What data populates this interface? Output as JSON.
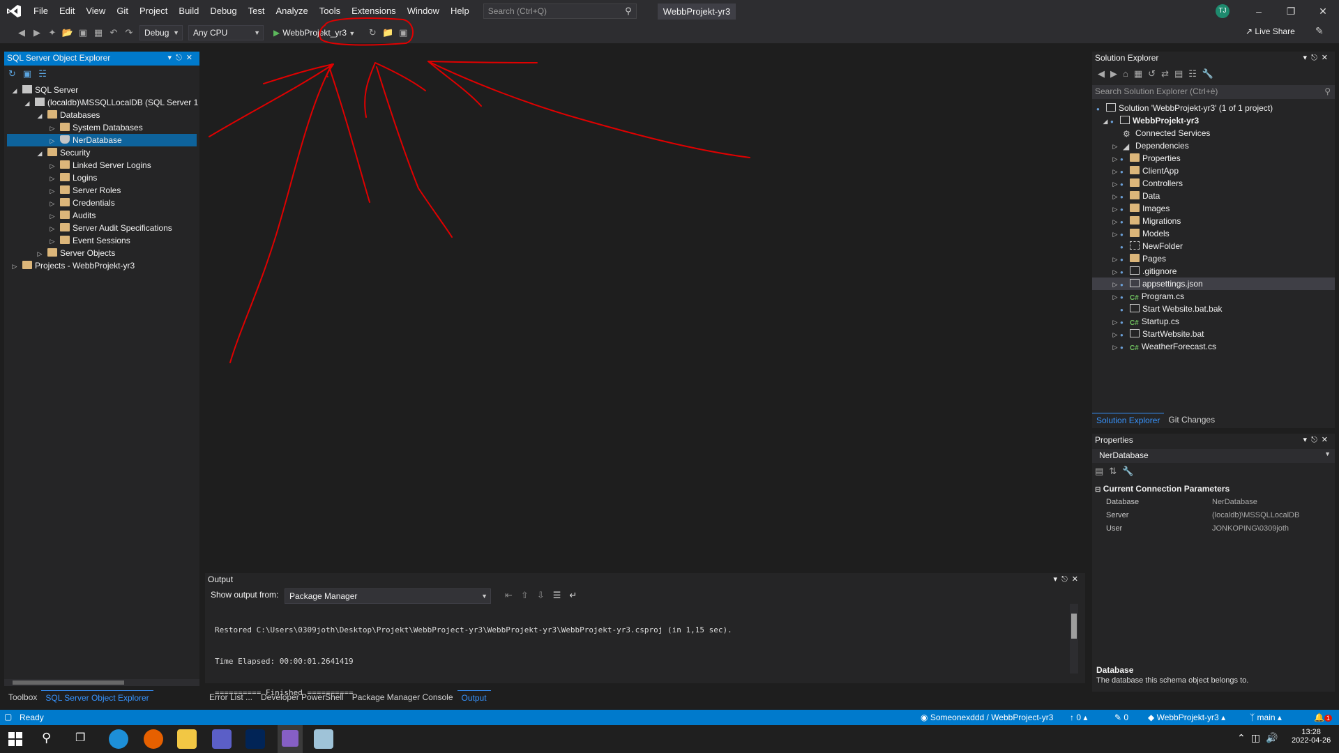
{
  "titlebar": {
    "menus": [
      "File",
      "Edit",
      "View",
      "Git",
      "Project",
      "Build",
      "Debug",
      "Test",
      "Analyze",
      "Tools",
      "Extensions",
      "Window",
      "Help"
    ],
    "search_placeholder": "Search (Ctrl+Q)",
    "solution_name": "WebbProjekt-yr3",
    "avatar_initials": "TJ"
  },
  "toolbar": {
    "config": "Debug",
    "platform": "Any CPU",
    "startup_project": "WebbProjekt_yr3",
    "live_share": "Live Share"
  },
  "sql_explorer": {
    "title": "SQL Server Object Explorer",
    "nodes": [
      {
        "label": "SQL Server",
        "icon": "server-icon"
      },
      {
        "label": "(localdb)\\MSSQLLocalDB (SQL Server 1",
        "icon": "server-instance-icon"
      },
      {
        "label": "Databases",
        "icon": "folder-icon"
      },
      {
        "label": "System Databases",
        "icon": "folder-icon"
      },
      {
        "label": "NerDatabase",
        "icon": "database-icon"
      },
      {
        "label": "Security",
        "icon": "folder-icon"
      },
      {
        "label": "Linked Server Logins",
        "icon": "folder-icon"
      },
      {
        "label": "Logins",
        "icon": "folder-icon"
      },
      {
        "label": "Server Roles",
        "icon": "folder-icon"
      },
      {
        "label": "Credentials",
        "icon": "folder-icon"
      },
      {
        "label": "Audits",
        "icon": "folder-icon"
      },
      {
        "label": "Server Audit Specifications",
        "icon": "folder-icon"
      },
      {
        "label": "Event Sessions",
        "icon": "folder-icon"
      },
      {
        "label": "Server Objects",
        "icon": "folder-icon"
      },
      {
        "label": "Projects - WebbProjekt-yr3",
        "icon": "folder-icon"
      }
    ],
    "tabs": [
      "Toolbox",
      "SQL Server Object Explorer"
    ]
  },
  "solution_explorer": {
    "title": "Solution Explorer",
    "search_placeholder": "Search Solution Explorer (Ctrl+è)",
    "solution": "Solution 'WebbProjekt-yr3' (1 of 1 project)",
    "project": "WebbProjekt-yr3",
    "items": [
      "Connected Services",
      "Dependencies",
      "Properties",
      "ClientApp",
      "Controllers",
      "Data",
      "Images",
      "Migrations",
      "Models",
      "NewFolder",
      "Pages",
      ".gitignore",
      "appsettings.json",
      "Program.cs",
      "Start Website.bat.bak",
      "Startup.cs",
      "StartWebsite.bat",
      "WeatherForecast.cs"
    ],
    "tabs": [
      "Solution Explorer",
      "Git Changes"
    ]
  },
  "properties": {
    "title": "Properties",
    "object": "NerDatabase",
    "category": "Current Connection Parameters",
    "rows": [
      {
        "key": "Database",
        "value": "NerDatabase"
      },
      {
        "key": "Server",
        "value": "(localdb)\\MSSQLLocalDB"
      },
      {
        "key": "User",
        "value": "JONKOPING\\0309joth"
      }
    ],
    "desc_title": "Database",
    "desc_text": "The database this schema object belongs to."
  },
  "output": {
    "title": "Output",
    "show_from_label": "Show output from:",
    "source": "Package Manager",
    "lines": [
      "Restored C:\\Users\\0309joth\\Desktop\\Projekt\\WebbProject-yr3\\WebbProjekt-yr3\\WebbProjekt-yr3.csproj (in 1,15 sec).",
      "Time Elapsed: 00:00:01.2641419",
      "========== Finished =========="
    ],
    "tabs": [
      "Error List ...",
      "Developer PowerShell",
      "Package Manager Console",
      "Output"
    ]
  },
  "statusbar": {
    "ready": "Ready",
    "repo": "Someonexddd / WebbProject-yr3",
    "push_count": "0",
    "changes_count": "0",
    "project": "WebbProjekt-yr3",
    "branch": "main",
    "notifications": "1"
  },
  "taskbar": {
    "time": "13:28",
    "date": "2022-04-26"
  },
  "colors": {
    "accent": "#007acc",
    "selection": "#0e639c",
    "annotation": "#e00000"
  }
}
